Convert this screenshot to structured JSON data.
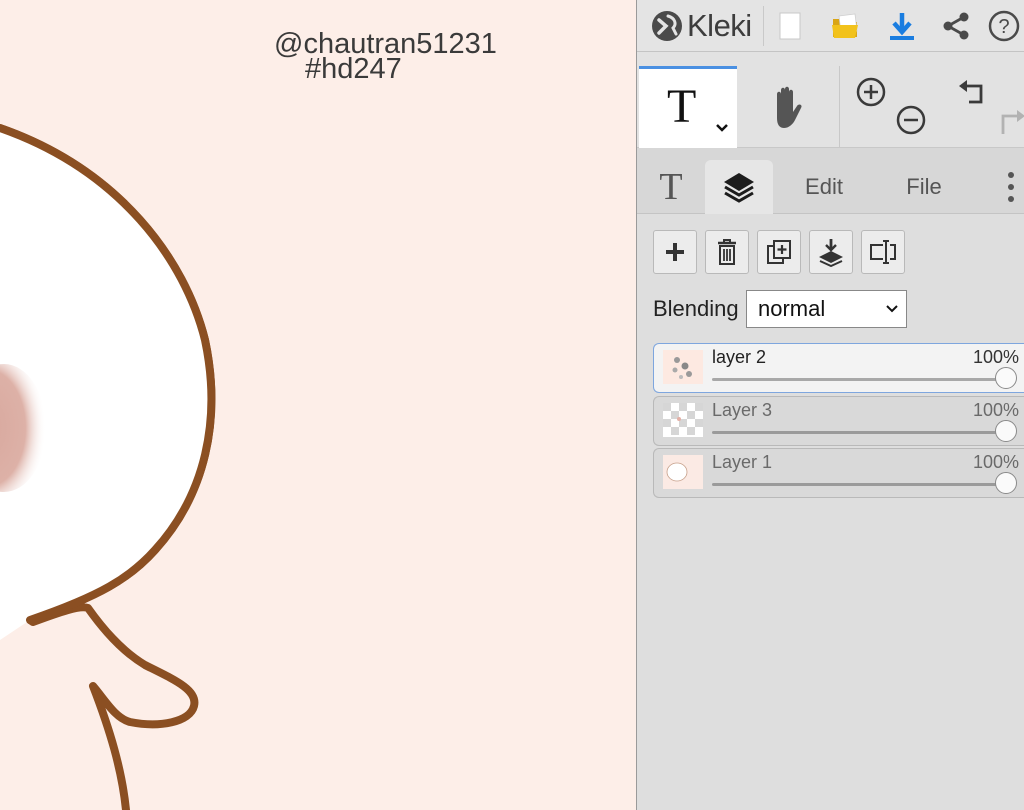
{
  "canvas": {
    "handle": "@chautran51231",
    "tag": "#hd247",
    "colors": {
      "background": "#fdeee8",
      "outline": "#8b4f22",
      "blush": "#d8a89e"
    }
  },
  "app": {
    "name": "Kleki"
  },
  "toolbar": {
    "icons": [
      "new-file-icon",
      "open-folder-icon",
      "download-icon",
      "share-icon",
      "help-icon"
    ],
    "accent": "#1a7de0",
    "help_glyph": "?"
  },
  "tools": {
    "active": "text",
    "text_tool_glyph": "T",
    "items": [
      "text-tool",
      "hand-tool",
      "zoom-in",
      "zoom-out",
      "undo",
      "redo"
    ]
  },
  "tabs": [
    {
      "label": "T",
      "icon": "text-tool-tab-icon"
    },
    {
      "label": "",
      "icon": "layers-icon",
      "active": true
    },
    {
      "label": "Edit"
    },
    {
      "label": "File"
    }
  ],
  "layer_actions": [
    "add-layer",
    "delete-layer",
    "duplicate-layer",
    "merge-layer-down",
    "rename-layer"
  ],
  "blending": {
    "label": "Blending",
    "value": "normal"
  },
  "layers": [
    {
      "name": "layer 2",
      "opacity_label": "100%",
      "opacity": 1.0,
      "active": true
    },
    {
      "name": "Layer 3",
      "opacity_label": "100%",
      "opacity": 1.0,
      "active": false
    },
    {
      "name": "Layer 1",
      "opacity_label": "100%",
      "opacity": 1.0,
      "active": false
    }
  ]
}
